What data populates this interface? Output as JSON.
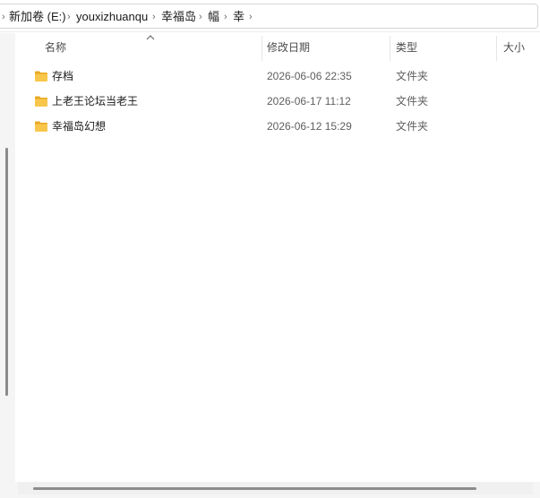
{
  "address_bar": {
    "crumbs": [
      "新加卷 (E:)",
      "youxizhuanqu",
      "幸福岛",
      "幅",
      "幸"
    ],
    "separator": "›"
  },
  "columns": {
    "name": "名称",
    "date_modified": "修改日期",
    "type": "类型",
    "size": "大小"
  },
  "sort": {
    "column": "name",
    "direction": "ascending",
    "icon": "chevron-up-icon"
  },
  "files": [
    {
      "name": "存档",
      "date_modified": "2026-06-06 22:35",
      "type": "文件夹",
      "icon": "folder-icon"
    },
    {
      "name": "上老王论坛当老王",
      "date_modified": "2026-06-17 11:12",
      "type": "文件夹",
      "icon": "folder-icon"
    },
    {
      "name": "幸福岛幻想",
      "date_modified": "2026-06-12 15:29",
      "type": "文件夹",
      "icon": "folder-icon"
    }
  ],
  "colors": {
    "folder_fill": "#f8c64b",
    "folder_tab": "#e9a823"
  }
}
